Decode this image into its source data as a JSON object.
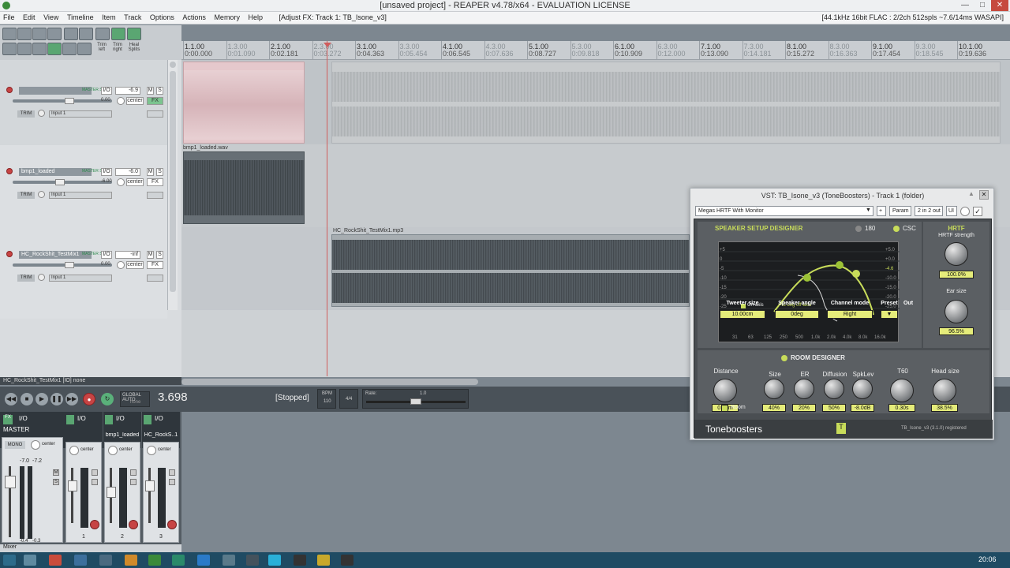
{
  "window": {
    "title": "[unsaved project] - REAPER v4.78/x64 - EVALUATION LICENSE"
  },
  "menu": {
    "items": [
      "File",
      "Edit",
      "View",
      "Timeline",
      "Item",
      "Track",
      "Options",
      "Actions",
      "Memory",
      "Help"
    ],
    "fx_info": "[Adjust FX: Track 1: TB_Isone_v3]",
    "audio_info": "[44.1kHz 16bit FLAC : 2/2ch 512spls ~7.6/14ms WASAPI]"
  },
  "toolbar": {
    "labels": [
      "Trim left",
      "Trim right",
      "Heal Splits"
    ]
  },
  "ruler": {
    "markers": [
      {
        "bar": "1.1.00",
        "time": "0:00.000"
      },
      {
        "bar": "1.3.00",
        "time": "0:01.090",
        "light": true
      },
      {
        "bar": "2.1.00",
        "time": "0:02.181"
      },
      {
        "bar": "2.3.00",
        "time": "0:03.272",
        "light": true
      },
      {
        "bar": "3.1.00",
        "time": "0:04.363"
      },
      {
        "bar": "3.3.00",
        "time": "0:05.454",
        "light": true
      },
      {
        "bar": "4.1.00",
        "time": "0:06.545"
      },
      {
        "bar": "4.3.00",
        "time": "0:07.636",
        "light": true
      },
      {
        "bar": "5.1.00",
        "time": "0:08.727"
      },
      {
        "bar": "5.3.00",
        "time": "0:09.818",
        "light": true
      },
      {
        "bar": "6.1.00",
        "time": "0:10.909"
      },
      {
        "bar": "6.3.00",
        "time": "0:12.000",
        "light": true
      },
      {
        "bar": "7.1.00",
        "time": "0:13.090"
      },
      {
        "bar": "7.3.00",
        "time": "0:14.181",
        "light": true
      },
      {
        "bar": "8.1.00",
        "time": "0:15.272"
      },
      {
        "bar": "8.3.00",
        "time": "0:16.363",
        "light": true
      },
      {
        "bar": "9.1.00",
        "time": "0:17.454"
      },
      {
        "bar": "9.3.00",
        "time": "0:18.545",
        "light": true
      },
      {
        "bar": "10.1.00",
        "time": "0:19.636"
      }
    ]
  },
  "tracks": [
    {
      "name": "",
      "number": "1",
      "volume": "-6.9",
      "pan": "center",
      "input": "Input 1",
      "io": "I/O",
      "master_send": "MASTER SEND",
      "m": "M",
      "s": "S",
      "fx": "FX",
      "trim": "TRIM",
      "pan_val": "0.00"
    },
    {
      "name": "bmp1_loaded",
      "number": "2",
      "volume": "-6.0",
      "pan": "center",
      "input": "Input 1",
      "io": "I/O",
      "master_send": "MASTER SEND",
      "m": "M",
      "s": "S",
      "fx": "FX",
      "trim": "TRIM",
      "pan_val": "-6.00"
    },
    {
      "name": "HC_RockShit_TestMix1",
      "number": "3",
      "volume": "-inf",
      "pan": "center",
      "input": "Input 1",
      "io": "I/O",
      "master_send": "MASTER SEND",
      "m": "M",
      "s": "S",
      "fx": "FX",
      "trim": "TRIM",
      "pan_val": "0.00"
    }
  ],
  "clips": [
    {
      "name": "bmp1_loaded.wav"
    },
    {
      "name": "HC_RockShit_TestMix1.mp3"
    }
  ],
  "status_line": "HC_RockShit_TestMix1 [IO] none",
  "transport": {
    "time": "3.698",
    "state": "[Stopped]",
    "bpm_label": "BPM",
    "bpm": "110",
    "sig": "4/4",
    "rate_label": "Rate:",
    "rate": "1.0",
    "global_auto": "GLOBAL AUTO",
    "global_auto_state": "none"
  },
  "mixer": {
    "strips": [
      {
        "name": "MASTER",
        "io": "I/O",
        "mono": "MONO",
        "pan": "center",
        "lvl_l": "-7.0",
        "lvl_r": "-7.2",
        "pk_l": "-0.4",
        "pk_r": "-0.3"
      },
      {
        "name": "",
        "io": "I/O",
        "pan": "center",
        "number": "1"
      },
      {
        "name": "bmp1_loaded",
        "io": "I/O",
        "pan": "center",
        "number": "2"
      },
      {
        "name": "HC_RockS..1",
        "io": "I/O",
        "pan": "center",
        "number": "3"
      }
    ],
    "tab": "Mixer"
  },
  "plugin": {
    "title": "VST: TB_Isone_v3 (ToneBoosters) - Track 1 (folder)",
    "preset": "Megas HRTF With Monitor",
    "buttons": [
      "+",
      "Param",
      "2 in 2 out",
      "UI"
    ],
    "ssd_title": "SPEAKER SETUP DESIGNER",
    "opt_180": "180",
    "opt_csc": "CSC",
    "hrtf_title": "HRTF",
    "hrtf_strength_label": "HRTF strength",
    "hrtf_strength": "100.0%",
    "ear_size_label": "Ear size",
    "ear_size": "96.5%",
    "graph_left": [
      "+5",
      "0",
      "-5",
      "-10",
      "-15",
      "-20",
      "-25"
    ],
    "graph_right": [
      "+5.0",
      "+0.0",
      "-4.6",
      "-10.0",
      "-15.0",
      "-20.0",
      "-25.0",
      "-30.0"
    ],
    "graph_x": [
      "31",
      "63",
      "125",
      "250",
      "500",
      "1.0k",
      "2.0k",
      "4.0k",
      "8.0k",
      "16.0k"
    ],
    "on_axis": "On-axis",
    "off_axis": "45 deg off-axis",
    "params": [
      {
        "label": "Tweeter size",
        "value": "10.00cm"
      },
      {
        "label": "Speaker angle",
        "value": "0deg"
      },
      {
        "label": "Channel mode",
        "value": "Right"
      },
      {
        "label": "Preset",
        "value": "▼"
      },
      {
        "label": "Out",
        "value": ""
      }
    ],
    "room_title": "ROOM DESIGNER",
    "room": [
      {
        "label": "Distance",
        "value": "0.75m"
      },
      {
        "label": "Size",
        "value": "40%"
      },
      {
        "label": "ER",
        "value": "20%"
      },
      {
        "label": "Diffusion",
        "value": "50%"
      },
      {
        "label": "SpkLev",
        "value": "-8.0dB"
      },
      {
        "label": "T60",
        "value": "0.30s"
      },
      {
        "label": "Head size",
        "value": "38.5%"
      }
    ],
    "room_toggle": "Room",
    "brand": "Toneboosters",
    "footer": "TB_Isone_v3 (3.1.0) registered"
  },
  "taskbar": {
    "clock": "20:06"
  }
}
